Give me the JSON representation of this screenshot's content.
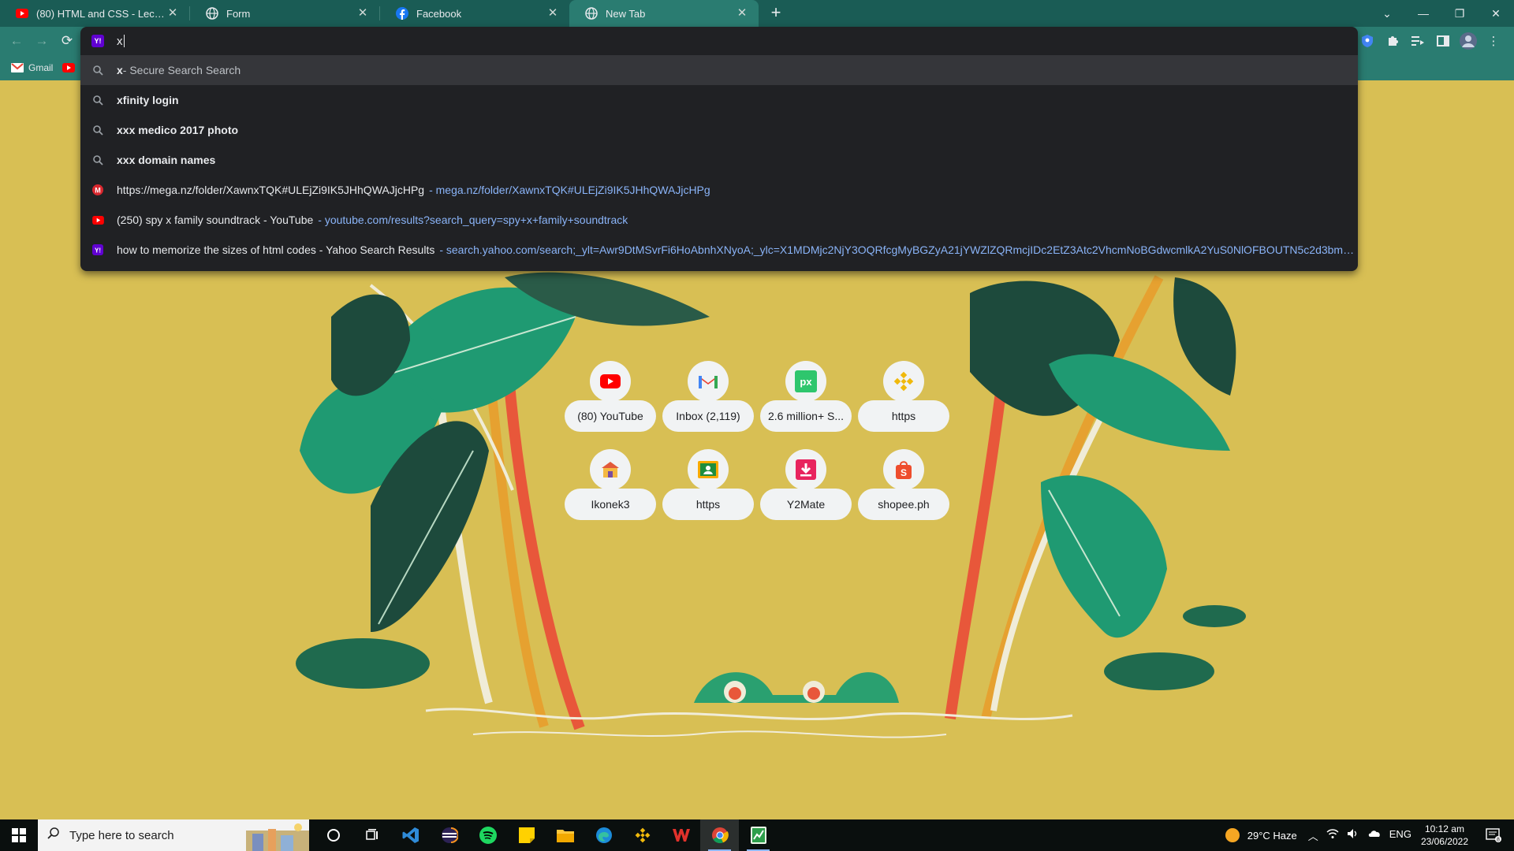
{
  "tabs": [
    {
      "title": "(80) HTML and CSS - Lecture 0 - ",
      "favicon": "youtube-icon",
      "active": false
    },
    {
      "title": "Form",
      "favicon": "globe-icon",
      "active": false
    },
    {
      "title": "Facebook",
      "favicon": "facebook-icon",
      "active": false
    },
    {
      "title": "New Tab",
      "favicon": "globe-icon",
      "active": true
    }
  ],
  "tab_close_glyph": "✕",
  "new_tab_glyph": "+",
  "window_controls": {
    "minimize": "—",
    "restore": "❐",
    "close": "✕",
    "tab_search": "⌄"
  },
  "toolbar": {
    "back": "←",
    "forward": "→",
    "reload": "⟳",
    "menu": "⋮"
  },
  "omnibox": {
    "query": "x",
    "engine_badge": "Y!",
    "suggestions": [
      {
        "type": "search",
        "icon": "search-icon",
        "bold": "x",
        "text": " - Secure Search Search",
        "url": "",
        "selected": true
      },
      {
        "type": "search",
        "icon": "search-icon",
        "bold": "xfinity login",
        "text": "",
        "url": "",
        "selected": false
      },
      {
        "type": "search",
        "icon": "search-icon",
        "bold": "xxx medico 2017 photo",
        "text": "",
        "url": "",
        "selected": false
      },
      {
        "type": "search",
        "icon": "search-icon",
        "bold": "xxx domain names",
        "text": "",
        "url": "",
        "selected": false
      },
      {
        "type": "history",
        "icon": "mega-icon",
        "bold": "",
        "text": "https://mega.nz/folder/XawnxTQK#ULEjZi9IK5JHhQWAJjcHPg",
        "url": "- mega.nz/folder/XawnxTQK#ULEjZi9IK5JHhQWAJjcHPg",
        "selected": false
      },
      {
        "type": "history",
        "icon": "youtube-icon",
        "bold": "",
        "text": "(250) spy x family soundtrack - YouTube",
        "url": "- youtube.com/results?search_query=spy+x+family+soundtrack",
        "selected": false
      },
      {
        "type": "history",
        "icon": "yahoo-icon",
        "bold": "",
        "text": "how to memorize the sizes of html codes - Yahoo Search Results",
        "url": "- search.yahoo.com/search;_ylt=Awr9DtMSvrFi6HoAbnhXNyoA;_ylc=X1MDMjc2NjY3OQRfcgMyBGZyA21jYWZlZQRmcjIDc2EtZ3Atc2VhcmNoBGdwcmlkA2YuS0NlOFBOUTN5c2d3bmphNU...",
        "selected": false
      }
    ]
  },
  "bookmarks": [
    {
      "label": "Gmail",
      "icon": "gmail-icon"
    },
    {
      "label": "",
      "icon": "youtube-icon"
    }
  ],
  "shortcuts": [
    {
      "label": "(80) YouTube",
      "icon": "youtube-icon"
    },
    {
      "label": "Inbox (2,119)",
      "icon": "gmail-icon"
    },
    {
      "label": "2.6 million+ S...",
      "icon": "pixabay-icon"
    },
    {
      "label": "https",
      "icon": "binance-icon"
    },
    {
      "label": "Ikonek3",
      "icon": "school-icon"
    },
    {
      "label": "https",
      "icon": "classroom-icon"
    },
    {
      "label": "Y2Mate",
      "icon": "y2mate-icon"
    },
    {
      "label": "shopee.ph",
      "icon": "shopee-icon"
    }
  ],
  "taskbar": {
    "search_placeholder": "Type here to search",
    "weather": "29°C  Haze",
    "language": "ENG",
    "time": "10:12 am",
    "date": "23/06/2022",
    "notification_count": "8"
  },
  "colors": {
    "tab_strip": "#1a5c55",
    "toolbar": "#2a7c71",
    "background": "#d8bf54",
    "omnibox": "#202124",
    "link": "#8ab4f8"
  }
}
